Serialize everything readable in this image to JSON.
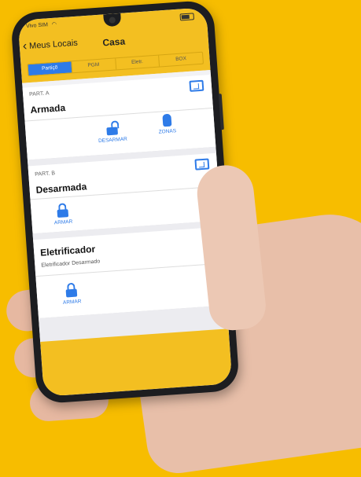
{
  "status_bar": {
    "carrier": "Vivo SIM"
  },
  "nav": {
    "back_label": "Meus Locais",
    "title": "Casa"
  },
  "tabs": [
    {
      "label": "Partiçõ",
      "active": true
    },
    {
      "label": "PGM"
    },
    {
      "label": "Eletr."
    },
    {
      "label": "BOX"
    }
  ],
  "partitions": [
    {
      "label": "PART. A",
      "state": "Armada",
      "actions": [
        {
          "label": "DESARMAR",
          "icon": "unlock-icon"
        },
        {
          "label": "ZONAS",
          "icon": "zones-icon"
        }
      ]
    },
    {
      "label": "PART. B",
      "state": "Desarmada",
      "actions": [
        {
          "label": "ARMAR",
          "icon": "lock-icon"
        }
      ]
    }
  ],
  "electrifier": {
    "title": "Eletrificador",
    "status": "Eletrificador Desarmado",
    "action_label": "ARMAR"
  },
  "colors": {
    "background": "#f7bd00",
    "header": "#f3bf21",
    "accent": "#2e7be8",
    "phone_body": "#1c1d20"
  }
}
